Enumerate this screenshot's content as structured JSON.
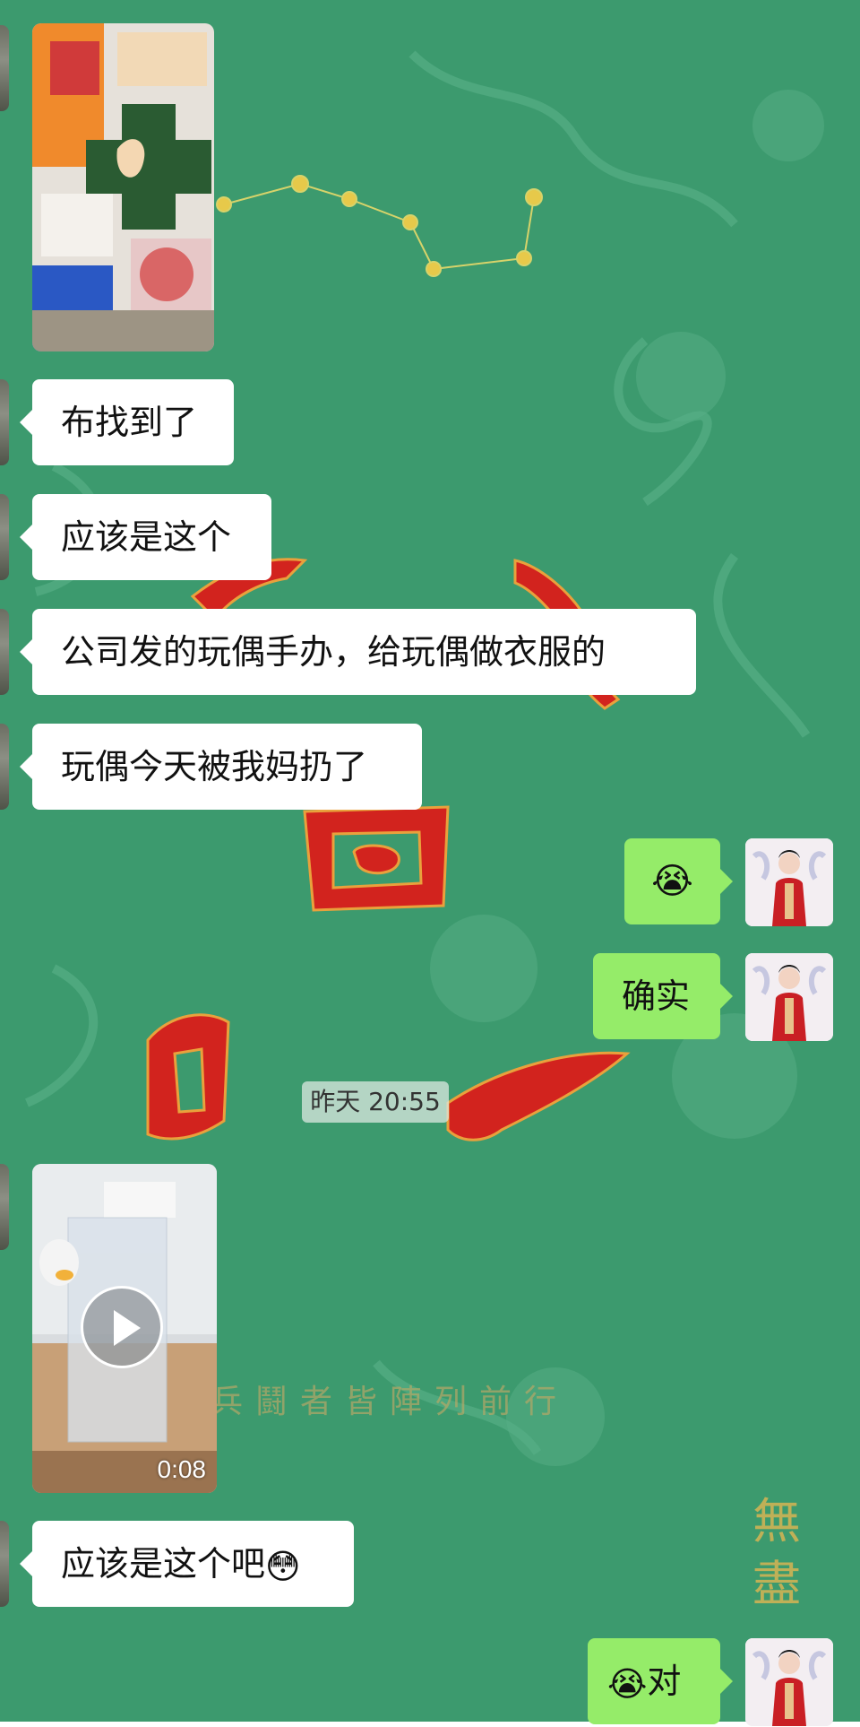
{
  "chat": {
    "messages": [
      {
        "type": "image",
        "side": "left",
        "description": "cloth pattern photo"
      },
      {
        "type": "text",
        "side": "left",
        "text": "布找到了"
      },
      {
        "type": "text",
        "side": "left",
        "text": "应该是这个"
      },
      {
        "type": "text",
        "side": "left",
        "text": "公司发的玩偶手办，给玩偶做衣服的"
      },
      {
        "type": "text",
        "side": "left",
        "text": "玩偶今天被我妈扔了"
      },
      {
        "type": "emoji",
        "side": "right",
        "emoji": "😭"
      },
      {
        "type": "text",
        "side": "right",
        "text": "确实"
      },
      {
        "type": "timestamp",
        "text": "昨天 20:55"
      },
      {
        "type": "video",
        "side": "left",
        "duration": "0:08"
      },
      {
        "type": "text",
        "side": "left",
        "text": "应该是这个吧",
        "emoji": "😳"
      },
      {
        "type": "text",
        "side": "right",
        "text": "对",
        "emoji": "😭"
      }
    ]
  },
  "background": {
    "theme_color": "#3c9a6e",
    "caption": "兵鬪者皆陣列前行",
    "vertical_text": "無盡"
  },
  "colors": {
    "sent_bubble": "#95ec69",
    "received_bubble": "#ffffff"
  }
}
